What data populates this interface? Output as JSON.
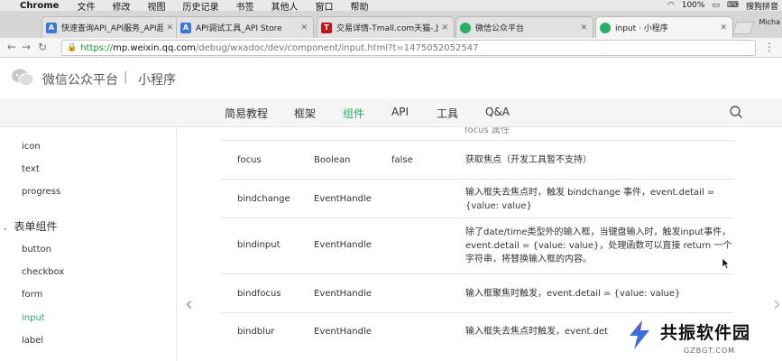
{
  "menubar": {
    "app_name": "Chrome",
    "items": [
      "文件",
      "修改",
      "视图",
      "历史记录",
      "书签",
      "其他人",
      "窗口",
      "帮助"
    ],
    "battery": "100%",
    "input_method": "搜狗拼音"
  },
  "tabs": [
    {
      "title": "快速查询API_API服务_API超",
      "favicon_letter": "A",
      "favicon_color": "#3b78d8"
    },
    {
      "title": "API调试工具_API Store",
      "favicon_letter": "A",
      "favicon_color": "#3b78d8"
    },
    {
      "title": "交易详情-Tmall.com天猫-上天",
      "favicon_letter": "T",
      "favicon_color": "#c3141c"
    },
    {
      "title": "微信公众平台",
      "favicon_letter": "",
      "favicon_color": "#2aae67"
    },
    {
      "title": "input · 小程序",
      "favicon_letter": "",
      "favicon_color": "#2aae67",
      "active": true
    }
  ],
  "profile_name": "Micha",
  "address": {
    "protocol": "https://",
    "host": "mp.weixin.qq.com",
    "path": "/debug/wxadoc/dev/component/input.html?t=1475052052547"
  },
  "site": {
    "title": "微信公众平台",
    "separator": "|",
    "subtitle": "小程序"
  },
  "nav": {
    "items": [
      "简易教程",
      "框架",
      "组件",
      "API",
      "工具",
      "Q&A"
    ],
    "active": "组件"
  },
  "sidebar": {
    "items_top": [
      "icon",
      "text",
      "progress"
    ],
    "group_label": "表单组件",
    "items_form": [
      "button",
      "checkbox",
      "form",
      "input",
      "label"
    ],
    "active": "input"
  },
  "table": {
    "cut_text": "focus 属性",
    "rows": [
      {
        "name": "focus",
        "type": "Boolean",
        "default": "false",
        "desc": "获取焦点（开发工具暂不支持）"
      },
      {
        "name": "bindchange",
        "type": "EventHandle",
        "default": "",
        "desc": "输入框失去焦点时，触发 bindchange 事件，event.detail = {value: value}"
      },
      {
        "name": "bindinput",
        "type": "EventHandle",
        "default": "",
        "desc": "除了date/time类型外的输入框，当键盘输入时，触发input事件，event.detail = {value: value}，处理函数可以直接 return 一个字符串，将替换输入框的内容。"
      },
      {
        "name": "bindfocus",
        "type": "EventHandle",
        "default": "",
        "desc": "输入框聚焦时触发，event.detail = {value: value}"
      },
      {
        "name": "bindblur",
        "type": "EventHandle",
        "default": "",
        "desc": "输入框失去焦点时触发，event.det"
      }
    ]
  },
  "watermark": {
    "name": "共振软件园",
    "domain": "GZBGT.COM"
  },
  "colors": {
    "accent_green": "#2aae67",
    "lock_green": "#1e8e3e"
  }
}
